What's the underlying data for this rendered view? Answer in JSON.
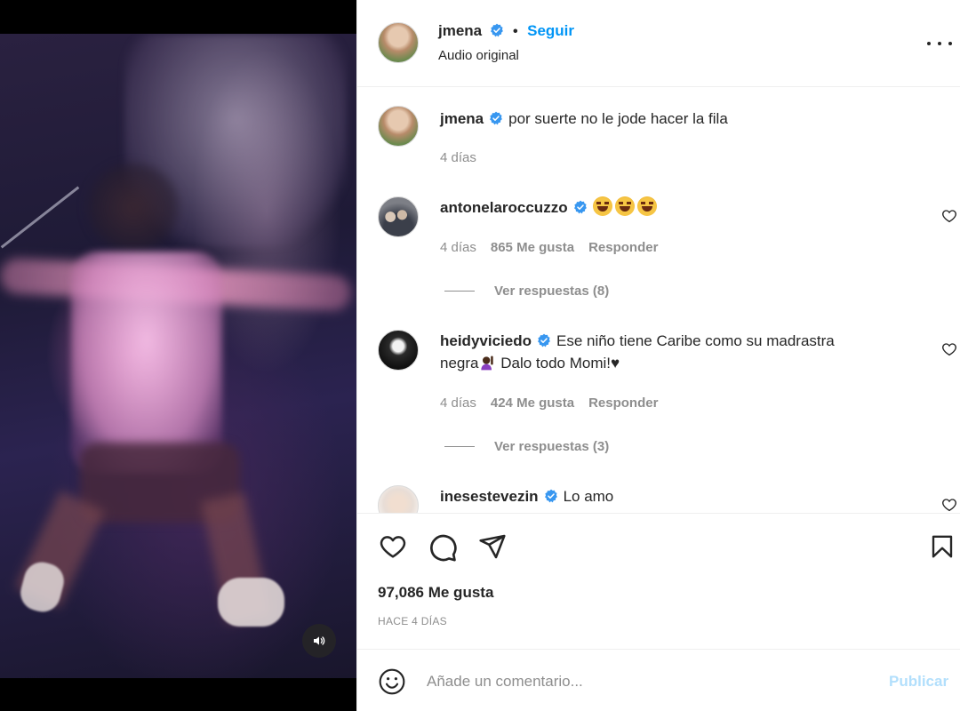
{
  "post": {
    "author": "jmena",
    "follow_label": "Seguir",
    "separator": "•",
    "audio_label": "Audio original",
    "caption": {
      "username": "jmena",
      "text": "por suerte no le jode hacer la fila",
      "time": "4 días"
    }
  },
  "comments": [
    {
      "username": "antonelaroccuzzo",
      "text": "",
      "emoji": [
        "laughing-tears",
        "laughing-tears",
        "laughing-tears"
      ],
      "time": "4 días",
      "likes": "865 Me gusta",
      "reply_label": "Responder",
      "view_replies": "Ver respuestas (8)"
    },
    {
      "username": "heidyviciedo",
      "text_line1": "Ese niño tiene Caribe como su madrastra",
      "text_line2_before": "negra",
      "text_line2_after": " Dalo todo Momi!♥",
      "time": "4 días",
      "likes": "424 Me gusta",
      "reply_label": "Responder",
      "view_replies": "Ver respuestas (3)"
    },
    {
      "username": "inesestevezin",
      "text": "Lo amo"
    }
  ],
  "actions": {
    "likes_count": "97,086 Me gusta",
    "timestamp": "HACE 4 DÍAS"
  },
  "add_comment": {
    "placeholder": "Añade un comentario...",
    "publish_label": "Publicar"
  },
  "icons": {
    "more": "more-horizontal-icon",
    "verified": "verified-badge-icon",
    "like": "heart-icon",
    "comment": "comment-bubble-icon",
    "share": "paper-plane-icon",
    "save": "bookmark-icon",
    "emoji": "smiley-icon",
    "volume": "volume-icon"
  },
  "colors": {
    "accent": "#0095f6",
    "verified": "#3897f0",
    "muted": "#8e8e8e",
    "publish_disabled": "#b2dffc"
  }
}
